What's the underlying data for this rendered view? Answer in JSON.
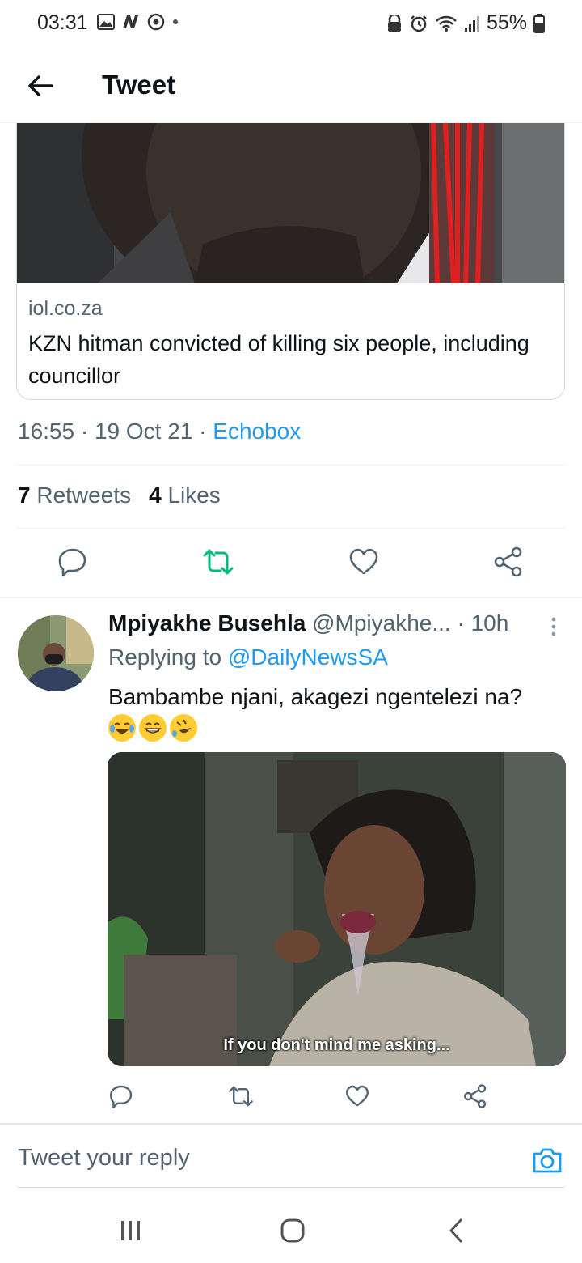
{
  "status_bar": {
    "time": "03:31",
    "battery": "55%",
    "left_icons": [
      "image-icon",
      "n-icon",
      "chrome-icon",
      "dot-icon"
    ],
    "right_icons": [
      "lock-icon",
      "alarm-icon",
      "wifi-icon",
      "signal-icon",
      "battery-icon"
    ]
  },
  "header": {
    "title": "Tweet"
  },
  "link_card": {
    "domain": "iol.co.za",
    "title": "KZN hitman convicted of killing six people, including councillor"
  },
  "tweet_meta": {
    "time": "16:55",
    "date": "19 Oct 21",
    "source": "Echobox",
    "separator": "·"
  },
  "stats": {
    "retweets_count": "7",
    "retweets_label": "Retweets",
    "likes_count": "4",
    "likes_label": "Likes"
  },
  "reply": {
    "name": "Mpiyakhe Busehla",
    "handle": "@Mpiyakhe...",
    "age": "· 10h",
    "replying_label": "Replying to",
    "replying_handle": "@DailyNewsSA",
    "text": "Bambambe njani, akagezi ngentelezi na?",
    "emojis": [
      "tears-of-joy",
      "grinning",
      "rolling-on-floor-laughing"
    ],
    "media_caption": "If you don't mind me asking..."
  },
  "composer": {
    "placeholder": "Tweet your reply"
  },
  "colors": {
    "accent": "#1d9bf0",
    "retweet_green": "#00ba7c",
    "secondary_text": "#536471"
  }
}
